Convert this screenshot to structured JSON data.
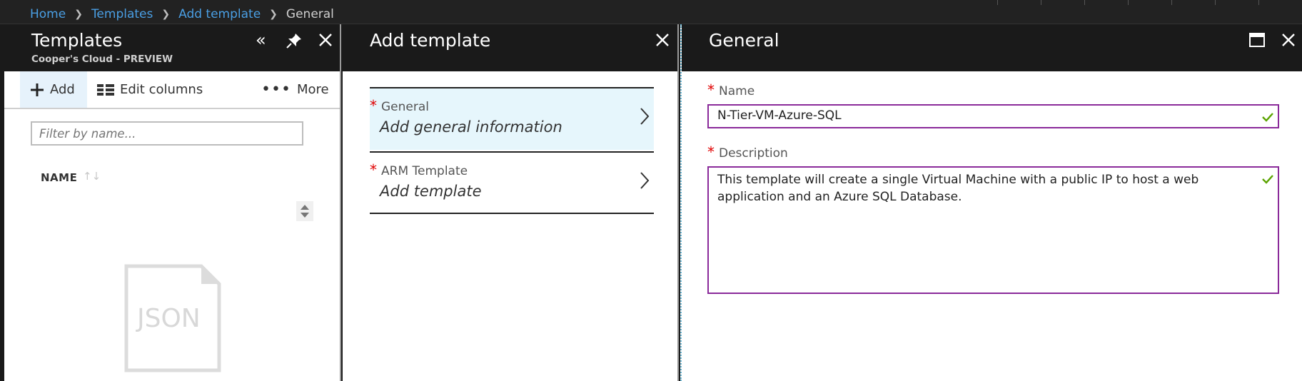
{
  "breadcrumb": {
    "items": [
      "Home",
      "Templates",
      "Add template"
    ],
    "current": "General"
  },
  "templates_blade": {
    "title": "Templates",
    "subtitle": "Cooper's Cloud - PREVIEW",
    "commands": {
      "add": "Add",
      "edit_columns": "Edit columns",
      "more": "More"
    },
    "filter_placeholder": "Filter by name...",
    "column_name": "NAME",
    "empty_icon_text": "JSON"
  },
  "add_template_blade": {
    "title": "Add template",
    "items": [
      {
        "label": "General",
        "value": "Add general information",
        "required": "*"
      },
      {
        "label": "ARM Template",
        "value": "Add template",
        "required": "*"
      }
    ]
  },
  "general_blade": {
    "title": "General",
    "name_label": "Name",
    "name_value": "N-Tier-VM-Azure-SQL",
    "description_label": "Description",
    "description_value": "This template will create a single Virtual Machine with a public IP to host a web application and an Azure SQL Database.",
    "required_marker": "*"
  },
  "colors": {
    "accent_link": "#4a9fe4",
    "selected_bg": "#e6f6fc",
    "field_border": "#8a2a9a",
    "valid_check": "#5ba300",
    "required": "#e00000"
  }
}
